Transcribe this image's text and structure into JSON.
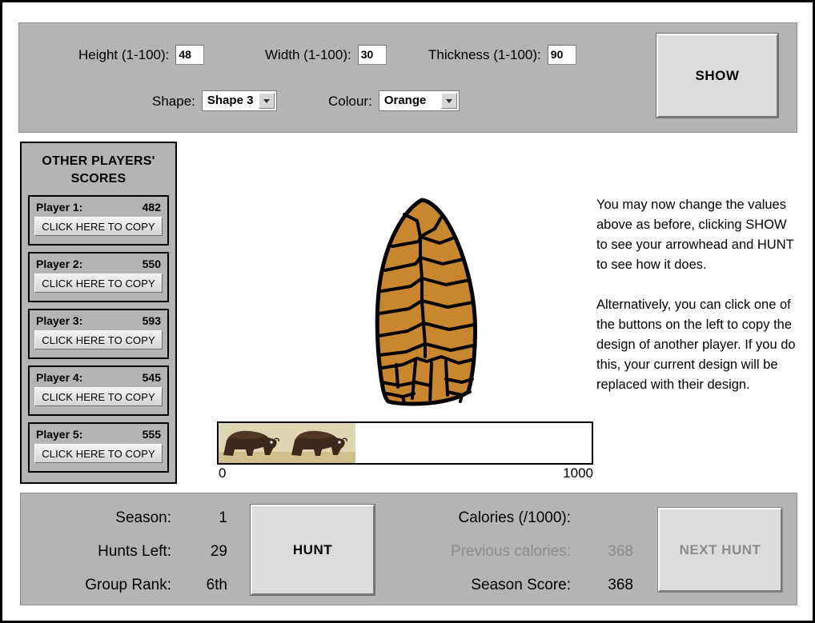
{
  "controls": {
    "height_label": "Height (1-100):",
    "height_value": "48",
    "width_label": "Width (1-100):",
    "width_value": "30",
    "thickness_label": "Thickness (1-100):",
    "thickness_value": "90",
    "shape_label": "Shape:",
    "shape_value": "Shape 3",
    "colour_label": "Colour:",
    "colour_value": "Orange",
    "show_label": "SHOW"
  },
  "sidebar": {
    "title": "OTHER PLAYERS' SCORES",
    "copy_label": "CLICK HERE TO COPY",
    "players": [
      {
        "name": "Player 1:",
        "score": "482"
      },
      {
        "name": "Player 2:",
        "score": "550"
      },
      {
        "name": "Player 3:",
        "score": "593"
      },
      {
        "name": "Player 4:",
        "score": "545"
      },
      {
        "name": "Player 5:",
        "score": "555"
      }
    ]
  },
  "arrowhead": {
    "fill_color": "#c8872e",
    "outline_color": "#000000"
  },
  "calorie_bar": {
    "min_label": "0",
    "max_label": "1000",
    "value": 368,
    "max_value": 1000,
    "fill_percent": 36.8
  },
  "instructions": {
    "paragraph_1": "You may now change the values above as before, clicking SHOW to see your arrowhead and HUNT to see how it does.",
    "paragraph_2": "Alternatively, you can click one of the buttons on the left to copy the design of another player. If you do this, your current design will be replaced with their design."
  },
  "status": {
    "season_label": "Season:",
    "season_value": "1",
    "hunts_left_label": "Hunts Left:",
    "hunts_left_value": "29",
    "group_rank_label": "Group Rank:",
    "group_rank_value": "6th",
    "calories_label": "Calories (/1000):",
    "calories_value": "",
    "previous_calories_label": "Previous calories:",
    "previous_calories_value": "368",
    "season_score_label": "Season Score:",
    "season_score_value": "368",
    "hunt_label": "HUNT",
    "next_hunt_label": "NEXT HUNT"
  }
}
